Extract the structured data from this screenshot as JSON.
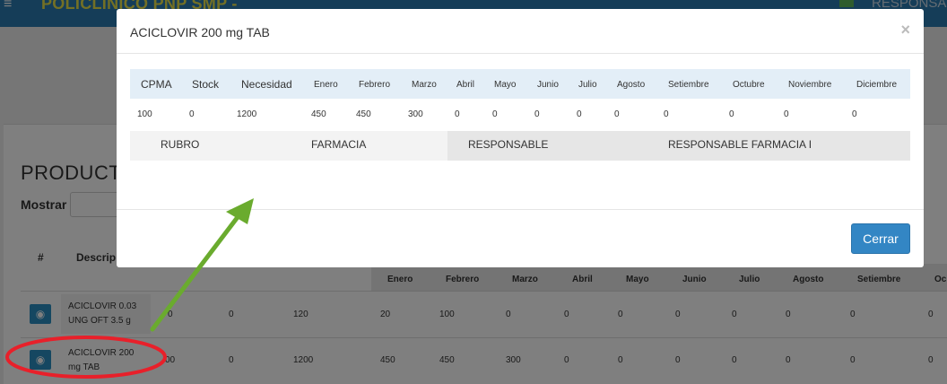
{
  "app": {
    "brand": "POLICLINICO PNP SMP -",
    "user": "RESPONSAB",
    "menu_icon": "hamburger-icon"
  },
  "page": {
    "panel_title": "PRODUCT",
    "mostrar_label": "Mostrar",
    "table": {
      "hash_label": "#",
      "desc_label": "Descrip",
      "month_headers": [
        "Enero",
        "Febrero",
        "Marzo",
        "Abril",
        "Mayo",
        "Junio",
        "Julio",
        "Agosto",
        "Setiembre",
        "Oc"
      ],
      "rows": [
        {
          "description": "ACICLOVIR 0.03 UNG OFT 3.5 g",
          "cpma": "0",
          "stock": "0",
          "necesidad": "120",
          "months": [
            "20",
            "100",
            "0",
            "0",
            "0",
            "0",
            "0",
            "0",
            "0",
            "0"
          ]
        },
        {
          "description": "ACICLOVIR 200 mg TAB",
          "cpma": "00",
          "stock": "0",
          "necesidad": "1200",
          "months": [
            "450",
            "450",
            "300",
            "0",
            "0",
            "0",
            "0",
            "0",
            "0",
            "0"
          ]
        }
      ]
    }
  },
  "modal": {
    "title": "ACICLOVIR 200 mg TAB",
    "close_symbol": "×",
    "headers": [
      "CPMA",
      "Stock",
      "Necesidad",
      "Enero",
      "Febrero",
      "Marzo",
      "Abril",
      "Mayo",
      "Junio",
      "Julio",
      "Agosto",
      "Setiembre",
      "Octubre",
      "Noviembre",
      "Diciembre"
    ],
    "values": [
      "100",
      "0",
      "1200",
      "450",
      "450",
      "300",
      "0",
      "0",
      "0",
      "0",
      "0",
      "0",
      "0",
      "0",
      "0"
    ],
    "rubro_label": "RUBRO",
    "rubro_value": "FARMACIA",
    "responsable_label": "RESPONSABLE",
    "responsable_value": "RESPONSABLE FARMACIA I",
    "close_button": "Cerrar"
  },
  "annotations": {
    "arrow_color": "#6aab2e",
    "circle_color": "#e8202a"
  },
  "colors": {
    "topbar": "#2a7ab0",
    "brand": "#e7e04a",
    "primary_button": "#3386c4",
    "modal_header_row": "#e3eef7"
  }
}
